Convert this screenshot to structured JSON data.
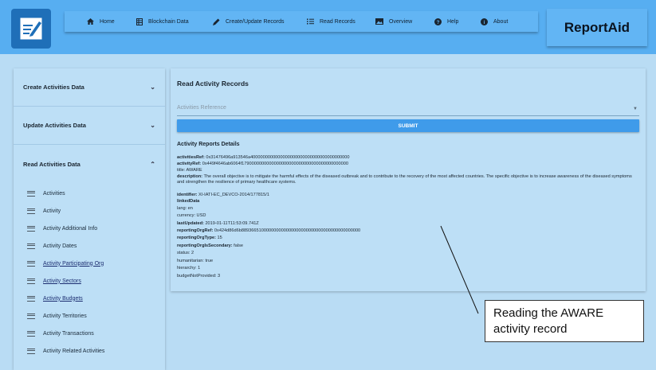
{
  "header": {
    "brand": "ReportAid",
    "nav": [
      {
        "label": "Home",
        "icon": "home-icon"
      },
      {
        "label": "Blockchain Data",
        "icon": "table-icon"
      },
      {
        "label": "Create/Update Records",
        "icon": "pencil-icon"
      },
      {
        "label": "Read Records",
        "icon": "list-icon"
      },
      {
        "label": "Overview",
        "icon": "photo-icon"
      },
      {
        "label": "Help",
        "icon": "help-icon"
      },
      {
        "label": "About",
        "icon": "info-icon"
      }
    ]
  },
  "sidebar": {
    "sections": [
      {
        "label": "Create Activities Data",
        "chevron": "⌄"
      },
      {
        "label": "Update Activities Data",
        "chevron": "⌄"
      },
      {
        "label": "Read Activities Data",
        "chevron": "⌃"
      }
    ],
    "items": [
      {
        "label": "Activities"
      },
      {
        "label": "Activity"
      },
      {
        "label": "Activity Additional Info"
      },
      {
        "label": "Activity Dates"
      },
      {
        "label": "Activity Participating Org"
      },
      {
        "label": "Activity Sectors"
      },
      {
        "label": "Activity Budgets"
      },
      {
        "label": "Activity Territories"
      },
      {
        "label": "Activity Transactions"
      },
      {
        "label": "Activity Related Activities"
      }
    ]
  },
  "main": {
    "title": "Read Activity Records",
    "select_placeholder": "Activities Reference",
    "submit_label": "SUBMIT",
    "details_title": "Activity Reports Details",
    "fields": [
      {
        "key": "activitiesRef:",
        "value": " 0x31476496a913546a4000000000000000000000000000000000000000"
      },
      {
        "key": "activityRef:",
        "value": " 0x449f4646ab6064f1790000000000000000000000000000000000000000"
      },
      {
        "key": "",
        "value": "title: AWARE"
      },
      {
        "key": "description:",
        "value": " The overall objective is to mitigate the harmful effects of the diseased outbreak and to contribute to the recovery of the most affected countries. The specific objective is to increase awareness of the diseased symptoms and strengthen the resilience of primary healthcare systems."
      },
      {
        "key": "identifier:",
        "value": " XI-IATI-EC_DEVCO-2014/177815/1"
      },
      {
        "key": "linkedData",
        "value": ""
      },
      {
        "key": "",
        "value": "lang: en"
      },
      {
        "key": "",
        "value": "currency: USD"
      },
      {
        "key": "lastUpdated:",
        "value": " 2019-01-11T11:53:09.741Z"
      },
      {
        "key": "reportingOrgRef:",
        "value": " 0x424d86d6b889366510000000000000000000000000000000000000000"
      },
      {
        "key": "reportingOrgType:",
        "value": " 15"
      },
      {
        "key": "reportingOrgIsSecondary:",
        "value": " false"
      },
      {
        "key": "",
        "value": "status: 2"
      },
      {
        "key": "",
        "value": "humanitarian: true"
      },
      {
        "key": "",
        "value": "hierarchy: 1"
      },
      {
        "key": "",
        "value": "budgetNotProvided: 3"
      }
    ]
  },
  "annotation": {
    "line1": "Reading the AWARE",
    "line2": "activity record"
  }
}
